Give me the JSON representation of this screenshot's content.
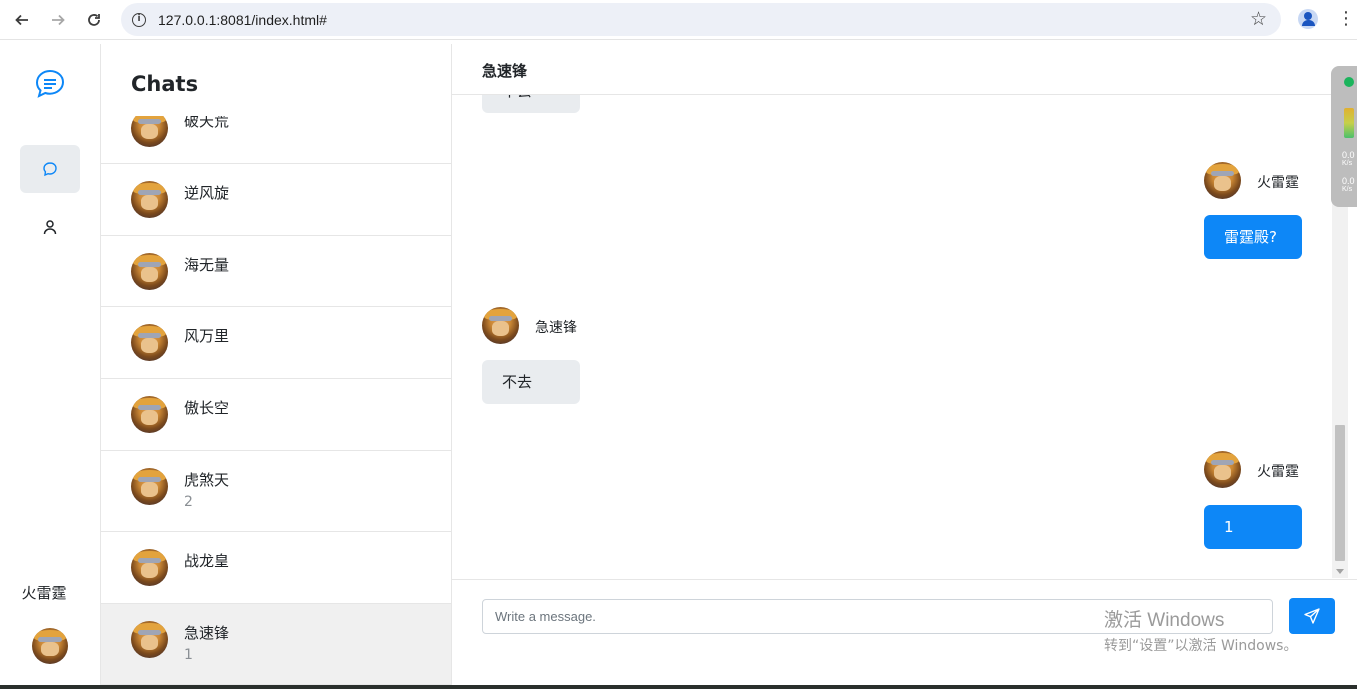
{
  "browser": {
    "url": "127.0.0.1:8081/index.html#"
  },
  "rail": {
    "user_name": "火雷霆"
  },
  "chat_list": {
    "title": "Chats",
    "items": [
      {
        "name": "破天荒",
        "sub": ""
      },
      {
        "name": "逆风旋",
        "sub": ""
      },
      {
        "name": "海无量",
        "sub": ""
      },
      {
        "name": "风万里",
        "sub": ""
      },
      {
        "name": "傲长空",
        "sub": ""
      },
      {
        "name": "虎煞天",
        "sub": "2"
      },
      {
        "name": "战龙皇",
        "sub": ""
      },
      {
        "name": "急速锋",
        "sub": "1"
      }
    ]
  },
  "conversation": {
    "title": "急速锋",
    "messages": [
      {
        "sender": "急速锋",
        "text": "不去",
        "direction": "in"
      },
      {
        "sender": "火雷霆",
        "text": "雷霆殿?",
        "direction": "out"
      },
      {
        "sender": "急速锋",
        "text": "不去",
        "direction": "in"
      },
      {
        "sender": "火雷霆",
        "text": "1",
        "direction": "out"
      }
    ],
    "input_placeholder": "Write a message."
  },
  "network_widget": {
    "upload": "0.0",
    "download": "0.0",
    "unit": "K/s"
  },
  "watermark": {
    "title": "激活 Windows",
    "subtitle": "转到“设置”以激活 Windows。"
  },
  "colors": {
    "accent": "#0d87f7",
    "incoming_bubble": "#e9ecef",
    "active_item": "#f0f0f0"
  }
}
